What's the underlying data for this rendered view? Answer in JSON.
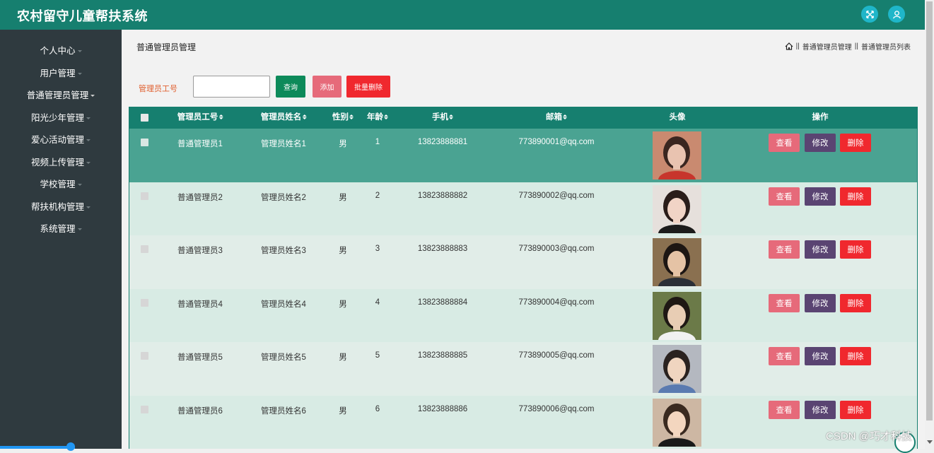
{
  "app": {
    "title": "农村留守儿童帮扶系统"
  },
  "header": {
    "icons": [
      "fullscreen-icon",
      "user-icon"
    ],
    "accent": "#167f6f",
    "icon_bg": "#1fb6c9"
  },
  "sidebar": {
    "items": [
      {
        "label": "个人中心"
      },
      {
        "label": "用户管理"
      },
      {
        "label": "普通管理员管理"
      },
      {
        "label": "阳光少年管理"
      },
      {
        "label": "爱心活动管理"
      },
      {
        "label": "视频上传管理"
      },
      {
        "label": "学校管理"
      },
      {
        "label": "帮扶机构管理"
      },
      {
        "label": "系统管理"
      }
    ]
  },
  "page": {
    "title": "普通管理员管理",
    "breadcrumb": [
      "普通管理员管理",
      "普通管理员列表"
    ],
    "breadcrumb_sep": "||"
  },
  "search": {
    "label": "管理员工号",
    "value": "",
    "placeholder": "",
    "query_label": "查询",
    "add_label": "添加",
    "batch_delete_label": "批量删除"
  },
  "table": {
    "headers": {
      "id": "管理员工号",
      "name": "管理员姓名",
      "gender": "性别",
      "age": "年龄",
      "phone": "手机",
      "email": "邮箱",
      "avatar": "头像",
      "actions": "操作"
    },
    "rows": [
      {
        "id": "普通管理员1",
        "name": "管理员姓名1",
        "gender": "男",
        "age": "1",
        "phone": "13823888881",
        "email": "773890001@qq.com"
      },
      {
        "id": "普通管理员2",
        "name": "管理员姓名2",
        "gender": "男",
        "age": "2",
        "phone": "13823888882",
        "email": "773890002@qq.com"
      },
      {
        "id": "普通管理员3",
        "name": "管理员姓名3",
        "gender": "男",
        "age": "3",
        "phone": "13823888883",
        "email": "773890003@qq.com"
      },
      {
        "id": "普通管理员4",
        "name": "管理员姓名4",
        "gender": "男",
        "age": "4",
        "phone": "13823888884",
        "email": "773890004@qq.com"
      },
      {
        "id": "普通管理员5",
        "name": "管理员姓名5",
        "gender": "男",
        "age": "5",
        "phone": "13823888885",
        "email": "773890005@qq.com"
      },
      {
        "id": "普通管理员6",
        "name": "管理员姓名6",
        "gender": "男",
        "age": "6",
        "phone": "13823888886",
        "email": "773890006@qq.com"
      }
    ],
    "actions": {
      "view": "查看",
      "edit": "修改",
      "delete": "删除"
    }
  },
  "colors": {
    "active_row": "#4aa392",
    "row_even": "#d8ebe4",
    "row_odd": "#e1ede8",
    "view_btn": "#e66a7a",
    "edit_btn": "#5a4472",
    "delete_btn": "#f0282e",
    "query_btn": "#0d8a5a"
  },
  "watermark": "CSDN @巧才科技"
}
